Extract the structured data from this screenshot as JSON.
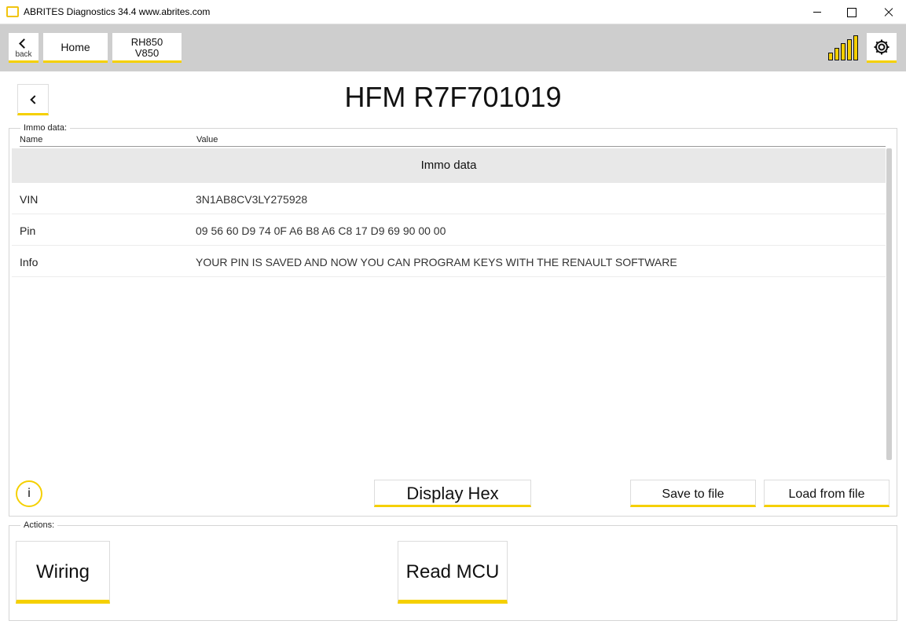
{
  "window": {
    "title": "ABRITES Diagnostics 34.4   www.abrites.com"
  },
  "toolbar": {
    "back_label": "back",
    "home_label": "Home",
    "model_line1": "RH850",
    "model_line2": "V850"
  },
  "page": {
    "title": "HFM R7F701019"
  },
  "immo": {
    "legend": "Immo data:",
    "col_name": "Name",
    "col_value": "Value",
    "section_label": "Immo data",
    "rows": [
      {
        "name": "VIN",
        "value": "3N1AB8CV3LY275928"
      },
      {
        "name": "Pin",
        "value": "09 56 60 D9 74 0F A6 B8 A6 C8 17 D9 69 90 00 00"
      },
      {
        "name": "Info",
        "value": "YOUR PIN IS SAVED AND NOW YOU CAN PROGRAM KEYS WITH THE RENAULT SOFTWARE"
      }
    ],
    "info_label": "i",
    "display_hex_label": "Display Hex",
    "save_label": "Save to file",
    "load_label": "Load from file"
  },
  "actions": {
    "legend": "Actions:",
    "wiring_label": "Wiring",
    "read_mcu_label": "Read MCU"
  },
  "colors": {
    "accent": "#f5d000",
    "toolbar_bg": "#cecece",
    "section_bg": "#e8e8e8"
  },
  "icons": {
    "app": "abrites-logo-icon",
    "back": "chevron-left-icon",
    "signal": "signal-strength-icon",
    "settings": "gear-icon"
  }
}
